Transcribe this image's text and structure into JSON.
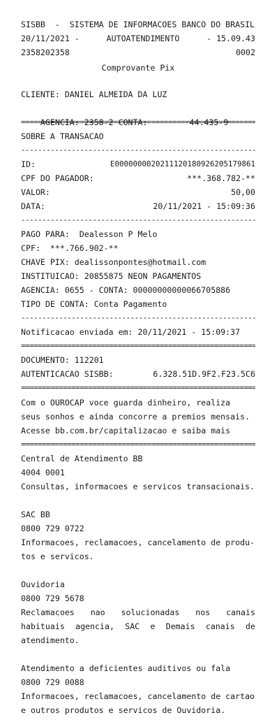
{
  "header": {
    "line1": "SISBB  -  SISTEMA DE INFORMACOES BANCO DO BRASIL",
    "date": "20/11/2021 -",
    "mode": "AUTOATENDIMENTO",
    "time": "- 15.09.43",
    "code_left": "2358202358",
    "code_right": "0002",
    "title": "Comprovante Pix"
  },
  "client": {
    "name_line": "CLIENTE: DANIEL ALMEIDA DA LUZ",
    "agency_label": "AGENCIA: 2358-2 CONTA:",
    "account": "44.435-9"
  },
  "separators": {
    "double": "====================================================================",
    "single": "--------------------------------------------------------------------"
  },
  "transaction": {
    "section_title": "SOBRE A TRANSACAO",
    "id_label": "ID:",
    "id_value": "E00000000202111201809262051798​61",
    "cpf_label": "CPF DO PAGADOR:",
    "cpf_value": "***.368.782-**",
    "valor_label": "VALOR:",
    "valor_value": "50,00",
    "data_label": "DATA:",
    "data_value": "20/11/2021 - 15:09:36"
  },
  "payee": {
    "pago_para": "PAGO PARA:  Dealesson P Melo",
    "cpf": "CPF:  ***.766.902-**",
    "chave_pix": "CHAVE PIX: dealissonpontes@hotmail.com",
    "instituicao": "INSTITUICAO: 20855875 NEON PAGAMENTOS",
    "agencia_conta": "AGENCIA: 0655 - CONTA: 00000000000066705886",
    "tipo_conta": "TIPO DE CONTA: Conta Pagamento"
  },
  "notification": "Notificacao enviada em: 20/11/2021 - 15:09:37",
  "document": {
    "documento": "DOCUMENTO: 112201",
    "auth_label": "AUTENTICACAO SISBB:",
    "auth_value": "6.328.51D.9F2.F23.5C6"
  },
  "ourocap": {
    "line1": "Com o OUROCAP voce guarda dinheiro, realiza",
    "line2": "seus sonhos e ainda concorre a premios mensais.",
    "line3": "Acesse bb.com.br/capitalizacao e saiba mais"
  },
  "central": {
    "title": "Central de Atendimento BB",
    "phone": "4004 0001",
    "desc": "Consultas, informacoes e servicos transacionais."
  },
  "sac": {
    "title": "SAC BB",
    "phone": "0800 729 0722",
    "desc1": "Informacoes, reclamacoes, cancelamento de produ-",
    "desc2": "tos e servicos."
  },
  "ouvidoria": {
    "title": "Ouvidoria",
    "phone": "0800 729 5678",
    "desc1": "Reclamacoes nao solucionadas nos canais",
    "desc2": "habituais agencia, SAC e Demais canais de",
    "desc3": "atendimento."
  },
  "deficientes": {
    "title": "Atendimento a deficientes auditivos ou fala",
    "phone": "0800 729 0088",
    "desc1": "Informacoes, reclamacoes, cancelamento de cartao",
    "desc2": "e outros produtos e servicos de Ouvidoria."
  }
}
